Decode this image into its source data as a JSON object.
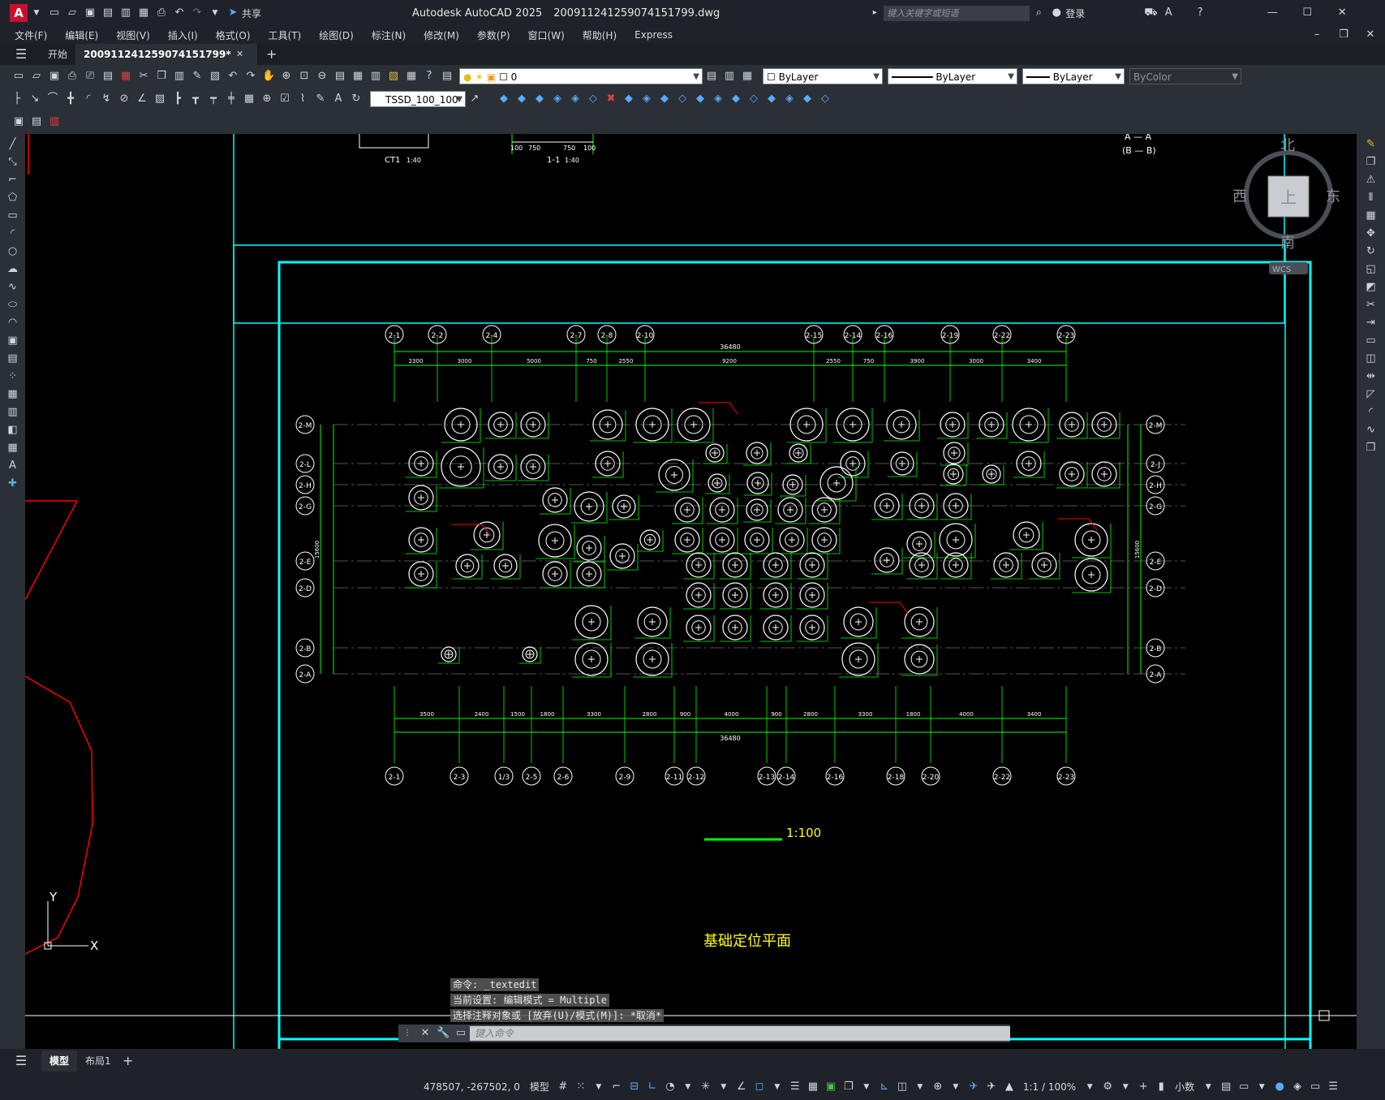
{
  "titlebar": {
    "app_icon": "A",
    "share_label": "共享",
    "title": "Autodesk AutoCAD 2025",
    "filename": "20091124125907415179​9.dwg",
    "search_placeholder": "键入关键字或短语",
    "login_label": "登录"
  },
  "menubar": {
    "items": [
      "文件(F)",
      "编辑(E)",
      "视图(V)",
      "插入(I)",
      "格式(O)",
      "工具(T)",
      "绘图(D)",
      "标注(N)",
      "修改(M)",
      "参数(P)",
      "窗口(W)",
      "帮助(H)",
      "Express"
    ]
  },
  "tabs": {
    "start": "开始",
    "doc": "20091124125907415179​9*"
  },
  "toolbar": {
    "layer_value": "0",
    "color_value": "ByLayer",
    "linetype_value": "ByLayer",
    "lineweight_value": "ByLayer",
    "plotstyle_value": "ByColor",
    "dimstyle_value": "TSSD_100_100"
  },
  "viewcube": {
    "north": "北",
    "south": "南",
    "east": "东",
    "west": "西",
    "top": "上",
    "wcs": "WCS"
  },
  "drawing": {
    "title": "基础定位平面",
    "scale": "1:100",
    "top_axes": [
      "2-1",
      "2-2",
      "2-4",
      "2-7",
      "2-8",
      "2-10",
      "2-15",
      "2-14",
      "2-16",
      "2-19",
      "2-22",
      "2-23"
    ],
    "bottom_axes": [
      "2-1",
      "2-3",
      "1/3",
      "2-5",
      "2-6",
      "2-9",
      "2-11",
      "2-12",
      "2-13",
      "2-14",
      "2-16",
      "2-18",
      "2-20",
      "2-22",
      "2-23"
    ],
    "left_axes": [
      "2-M",
      "2-L",
      "2-H",
      "2-G",
      "2-E",
      "2-D",
      "2-B",
      "2-A"
    ],
    "right_axes": [
      "2-M",
      "2-J",
      "2-H",
      "2-G",
      "2-E",
      "2-D",
      "2-B",
      "2-A"
    ],
    "top_total": "36480",
    "top_dims": [
      "2300",
      "3000",
      "5000",
      "750",
      "2550",
      "9200",
      "2550",
      "750",
      "3900",
      "3000",
      "3400"
    ],
    "bottom_total": "36480",
    "bottom_dims": [
      "3500",
      "2400",
      "1500",
      "1800",
      "3300",
      "2800",
      "900",
      "4000",
      "900",
      "2800",
      "3300",
      "1800",
      "4000",
      "3400"
    ],
    "left_total": "15600",
    "right_total": "15600",
    "top_fragment_labels": [
      "CT1",
      "1:40",
      "1-1",
      "1:40",
      "750",
      "750",
      "100",
      "100",
      "A — A",
      "(B — B)"
    ],
    "axis_y": "Y",
    "axis_x": "X"
  },
  "command": {
    "line1": "命令: _textedit",
    "line2": "当前设置: 编辑模式 = Multiple",
    "line3": "选择注释对象或 [放弃(U)/模式(M)]: *取消*",
    "placeholder": "键入命令"
  },
  "layouttabs": {
    "model": "模型",
    "layout1": "布局1"
  },
  "statusbar": {
    "coords": "478507, -267502, 0",
    "model": "模型",
    "scale": "1:1 / 100%",
    "units": "小数"
  },
  "colors": {
    "accent_cyan": "#00ffff",
    "line_green": "#00ff00",
    "red": "#ff0000",
    "yellow": "#ffff00",
    "chrome": "#2b2f36"
  }
}
